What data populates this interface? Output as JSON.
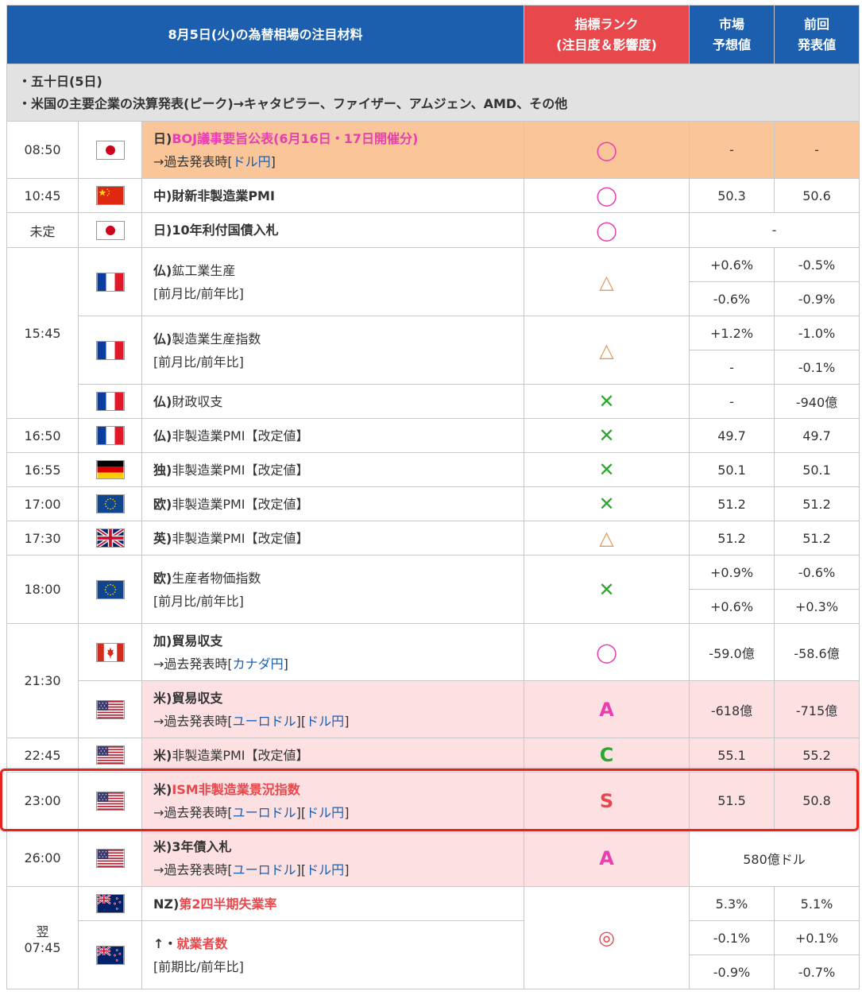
{
  "header": {
    "title": "8月5日(火)の為替相場の注目材料",
    "rank_line1": "指標ランク",
    "rank_line2": "(注目度＆影響度)",
    "forecast_line1": "市場",
    "forecast_line2": "予想値",
    "previous_line1": "前回",
    "previous_line2": "発表値"
  },
  "intro": {
    "line1": "・五十日(5日)",
    "line2": "・米国の主要企業の決算発表(ピーク)→キャタピラー、ファイザー、アムジェン、AMD、その他"
  },
  "rows": [
    {
      "time": "08:50",
      "flag": "japan-flag",
      "prefix": "日)",
      "title": "BOJ議事要旨公表(6月16日・17日開催分)",
      "past": "→過去発表時[",
      "links": [
        "ドル円"
      ],
      "close": "]",
      "rank": "◯",
      "forecast": "-",
      "previous": "-"
    },
    {
      "time": "10:45",
      "flag": "china-flag",
      "title": "中)財新非製造業PMI",
      "rank": "◯",
      "forecast": "50.3",
      "previous": "50.6"
    },
    {
      "time": "未定",
      "flag": "japan-flag",
      "title": "日)10年利付国債入札",
      "rank": "◯",
      "merged": "-"
    },
    {
      "time": "15:45",
      "flag": "france-flag",
      "prefix": "仏)",
      "title": "鉱工業生産",
      "sub": "[前月比/前年比]",
      "rank": "△",
      "forecast": [
        "+0.6%",
        "-0.6%"
      ],
      "previous": [
        "-0.5%",
        "-0.9%"
      ]
    },
    {
      "flag": "france-flag",
      "prefix": "仏)",
      "title": "製造業生産指数",
      "sub": "[前月比/前年比]",
      "rank": "△",
      "forecast": [
        "+1.2%",
        "-"
      ],
      "previous": [
        "-1.0%",
        "-0.1%"
      ]
    },
    {
      "flag": "france-flag",
      "prefix": "仏)",
      "title": "財政収支",
      "rank": "✕",
      "forecast": "-",
      "previous": "-940億"
    },
    {
      "time": "16:50",
      "flag": "france-flag",
      "prefix": "仏)",
      "title": "非製造業PMI【改定値】",
      "rank": "✕",
      "forecast": "49.7",
      "previous": "49.7"
    },
    {
      "time": "16:55",
      "flag": "germany-flag",
      "prefix": "独)",
      "title": "非製造業PMI【改定値】",
      "rank": "✕",
      "forecast": "50.1",
      "previous": "50.1"
    },
    {
      "time": "17:00",
      "flag": "eu-flag",
      "prefix": "欧)",
      "title": "非製造業PMI【改定値】",
      "rank": "✕",
      "forecast": "51.2",
      "previous": "51.2"
    },
    {
      "time": "17:30",
      "flag": "uk-flag",
      "prefix": "英)",
      "title": "非製造業PMI【改定値】",
      "rank": "△",
      "forecast": "51.2",
      "previous": "51.2"
    },
    {
      "time": "18:00",
      "flag": "eu-flag",
      "prefix": "欧)",
      "title": "生産者物価指数",
      "sub": "[前月比/前年比]",
      "rank": "✕",
      "forecast": [
        "+0.9%",
        "+0.6%"
      ],
      "previous": [
        "-0.6%",
        "+0.3%"
      ]
    },
    {
      "time": "21:30",
      "flag": "canada-flag",
      "title": "加)貿易収支",
      "past": "→過去発表時[",
      "links": [
        "カナダ円"
      ],
      "close": "]",
      "rank": "◯",
      "forecast": "-59.0億",
      "previous": "-58.6億"
    },
    {
      "flag": "us-flag",
      "title": "米)貿易収支",
      "past": "→過去発表時[",
      "links": [
        "ユーロドル",
        "ドル円"
      ],
      "close": "]",
      "rank": "A",
      "forecast": "-618億",
      "previous": "-715億"
    },
    {
      "time": "22:45",
      "flag": "us-flag",
      "prefix": "米)",
      "title": "非製造業PMI【改定値】",
      "rank": "C",
      "forecast": "55.1",
      "previous": "55.2"
    },
    {
      "time": "23:00",
      "flag": "us-flag",
      "prefix": "米)",
      "title": "ISM非製造業景況指数",
      "past": "→過去発表時[",
      "links": [
        "ユーロドル",
        "ドル円"
      ],
      "close": "]",
      "rank": "S",
      "forecast": "51.5",
      "previous": "50.8"
    },
    {
      "time": "26:00",
      "flag": "us-flag",
      "title": "米)3年債入札",
      "past": "→過去発表時[",
      "links": [
        "ユーロドル",
        "ドル円"
      ],
      "close": "]",
      "rank": "A",
      "merged": "580億ドル"
    },
    {
      "time_line1": "翌",
      "time_line2": "07:45",
      "flag": "nz-flag",
      "prefix": "NZ)",
      "title": "第2四半期失業率",
      "rank": "◎",
      "forecast": "5.3%",
      "previous": "5.1%"
    },
    {
      "flag": "nz-flag",
      "prefix": "↑・",
      "title": "就業者数",
      "sub": "[前期比/前年比]",
      "forecast": [
        "-0.1%",
        "-0.9%"
      ],
      "previous": [
        "+0.1%",
        "-0.7%"
      ]
    }
  ]
}
